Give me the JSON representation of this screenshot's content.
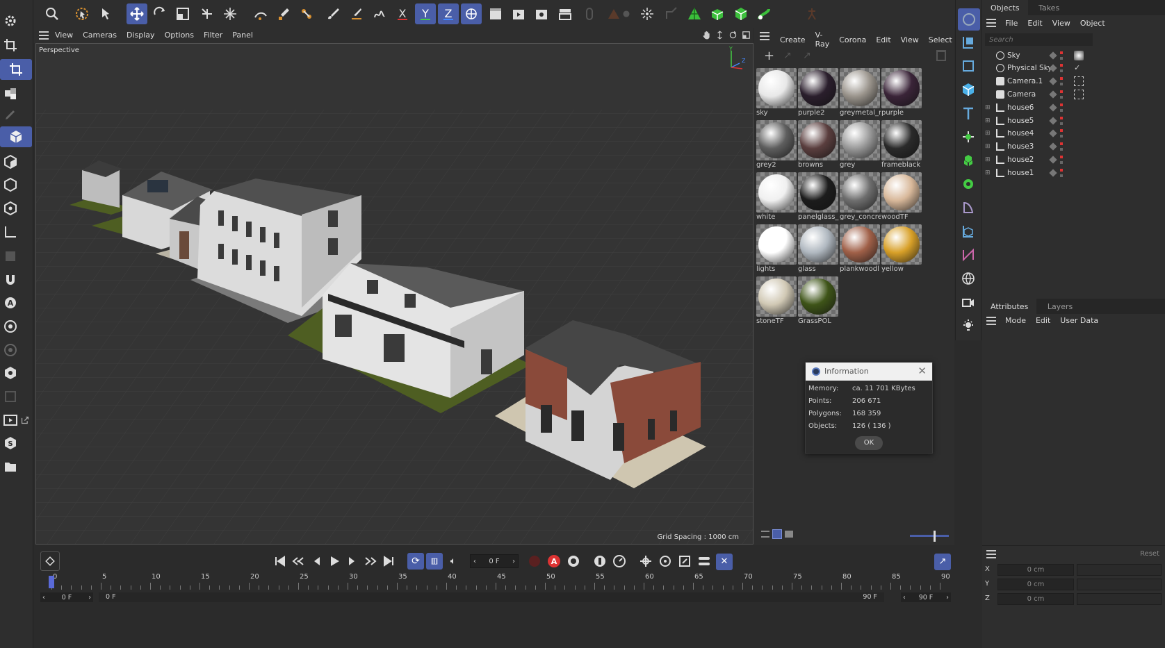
{
  "viewport": {
    "menu": [
      "View",
      "Cameras",
      "Display",
      "Options",
      "Filter",
      "Panel"
    ],
    "label": "Perspective",
    "grid_spacing": "Grid Spacing : 1000 cm",
    "axis_y": "Y",
    "axis_z": "Z"
  },
  "materials": {
    "menu": [
      "Create",
      "V-Ray",
      "Corona",
      "Edit",
      "View",
      "Select"
    ],
    "items": [
      {
        "name": "sky",
        "color": "#e8e8e8"
      },
      {
        "name": "purple2",
        "color": "#2a1e2c"
      },
      {
        "name": "greymetal_r",
        "color": "#9a948c"
      },
      {
        "name": "purple",
        "color": "#3a2438"
      },
      {
        "name": "grey2",
        "color": "#5e5e5e"
      },
      {
        "name": "browns",
        "color": "#5a3e3e"
      },
      {
        "name": "grey",
        "color": "#9a9a9a"
      },
      {
        "name": "frameblack",
        "color": "#2a2a2a"
      },
      {
        "name": "white",
        "color": "#f0f0f0"
      },
      {
        "name": "panelglass_",
        "color": "#1c1c1c"
      },
      {
        "name": "grey_concre",
        "color": "#6e6e6e"
      },
      {
        "name": "woodTF",
        "color": "#d8b89a"
      },
      {
        "name": "lights",
        "color": "#ffffff"
      },
      {
        "name": "glass",
        "color": "#b0b8c0"
      },
      {
        "name": "plankwoodl",
        "color": "#a06048"
      },
      {
        "name": "yellow",
        "color": "#d8a028"
      },
      {
        "name": "stoneTF",
        "color": "#d0c8b4"
      },
      {
        "name": "GrassPOL",
        "color": "#3e5418"
      }
    ]
  },
  "objects": {
    "tabs": [
      "Objects",
      "Takes"
    ],
    "menu": [
      "File",
      "Edit",
      "View",
      "Object"
    ],
    "search_placeholder": "Search",
    "items": [
      "Sky",
      "Physical Sky",
      "Camera.1",
      "Camera",
      "house6",
      "house5",
      "house4",
      "house3",
      "house2",
      "house1"
    ]
  },
  "attributes": {
    "tabs": [
      "Attributes",
      "Layers"
    ],
    "menu": [
      "Mode",
      "Edit",
      "User Data"
    ],
    "reset": "Reset",
    "coords": [
      {
        "axis": "X",
        "value": "0 cm"
      },
      {
        "axis": "Y",
        "value": "0 cm"
      },
      {
        "axis": "Z",
        "value": "0 cm"
      }
    ]
  },
  "info_dialog": {
    "title": "Information",
    "rows": [
      {
        "label": "Memory:",
        "value": "ca. 11 701 KBytes"
      },
      {
        "label": "Points:",
        "value": "206 671"
      },
      {
        "label": "Polygons:",
        "value": "168 359"
      },
      {
        "label": "Objects:",
        "value": "126 ( 136 )"
      }
    ],
    "ok": "OK"
  },
  "timeline": {
    "current_frame": "0 F",
    "ticks": [
      "0",
      "5",
      "10",
      "15",
      "20",
      "25",
      "30",
      "35",
      "40",
      "45",
      "50",
      "55",
      "60",
      "65",
      "70",
      "75",
      "80",
      "85",
      "90"
    ],
    "start": "0 F",
    "range_start": "0 F",
    "range_end": "90 F",
    "end": "90 F"
  },
  "colors": {
    "accent": "#4a5ea8",
    "bg": "#2b2b2b",
    "viewport": "#333333"
  }
}
